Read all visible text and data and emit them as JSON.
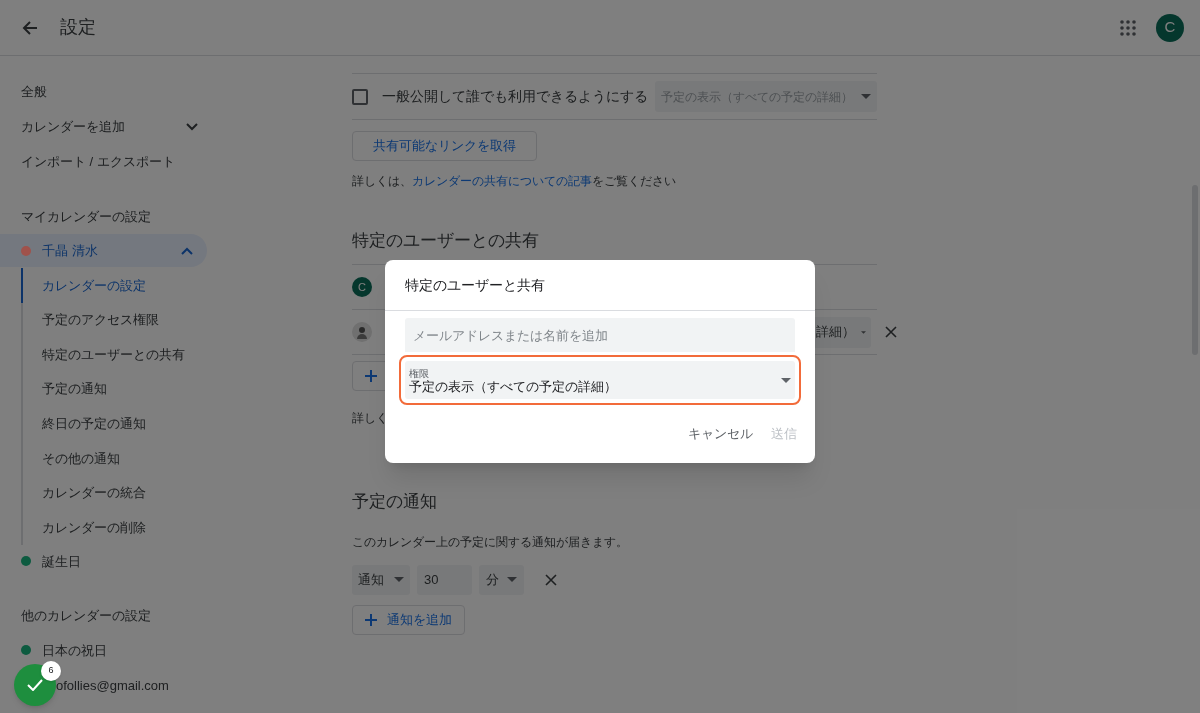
{
  "header": {
    "title": "設定",
    "avatar_letter": "C"
  },
  "sidebar": {
    "top_items": [
      {
        "label": "全般"
      },
      {
        "label": "カレンダーを追加",
        "expanded": false
      },
      {
        "label": "インポート / エクスポート"
      }
    ],
    "my_calendars": {
      "heading": "マイカレンダーの設定",
      "calendars": [
        {
          "name": "千晶 清水",
          "color": "#a0524b",
          "expanded": true,
          "selected": true,
          "children": [
            {
              "label": "カレンダーの設定",
              "selected": true
            },
            {
              "label": "予定のアクセス権限",
              "selected": false
            },
            {
              "label": "特定のユーザーとの共有",
              "selected": false
            },
            {
              "label": "予定の通知",
              "selected": false
            },
            {
              "label": "終日の予定の通知",
              "selected": false
            },
            {
              "label": "その他の通知",
              "selected": false
            },
            {
              "label": "カレンダーの統合",
              "selected": false
            },
            {
              "label": "カレンダーの削除",
              "selected": false
            }
          ]
        },
        {
          "name": "誕生日",
          "color": "#0d5b40",
          "selected": false
        }
      ]
    },
    "other_calendars": {
      "heading": "他のカレンダーの設定",
      "calendars": [
        {
          "name": "日本の祝日",
          "color": "#0d5b40"
        },
        {
          "name": "ofollies@gmail.com"
        }
      ]
    }
  },
  "access": {
    "public_checkbox": {
      "label": "一般公開して誰でも利用できるようにする",
      "checked": false
    },
    "permission_select": "予定の表示（すべての予定の詳細）",
    "link_button": "共有可能なリンクを取得",
    "info": {
      "prefix": "詳しくは、",
      "link": "カレンダーの共有についての記事",
      "suffix": "をご覧ください"
    }
  },
  "sharing": {
    "heading": "特定のユーザーとの共有",
    "users": [
      {
        "kind": "letter",
        "avatar": "C"
      },
      {
        "kind": "photo",
        "permission": "詳細）"
      }
    ],
    "info": "詳しく"
  },
  "notifications": {
    "heading": "予定の通知",
    "description": "このカレンダー上の予定に関する通知が届きます。",
    "rows": [
      {
        "type": "通知",
        "value": "30",
        "unit": "分"
      }
    ],
    "add_button": "通知を追加"
  },
  "dialog": {
    "title": "特定のユーザーと共有",
    "email_placeholder": "メールアドレスまたは名前を追加",
    "permission": {
      "label": "権限",
      "value": "予定の表示（すべての予定の詳細）",
      "focused": true
    },
    "buttons": [
      {
        "label": "キャンセル",
        "disabled": false
      },
      {
        "label": "送信",
        "disabled": true
      }
    ]
  },
  "fab": {
    "badge": "6"
  }
}
